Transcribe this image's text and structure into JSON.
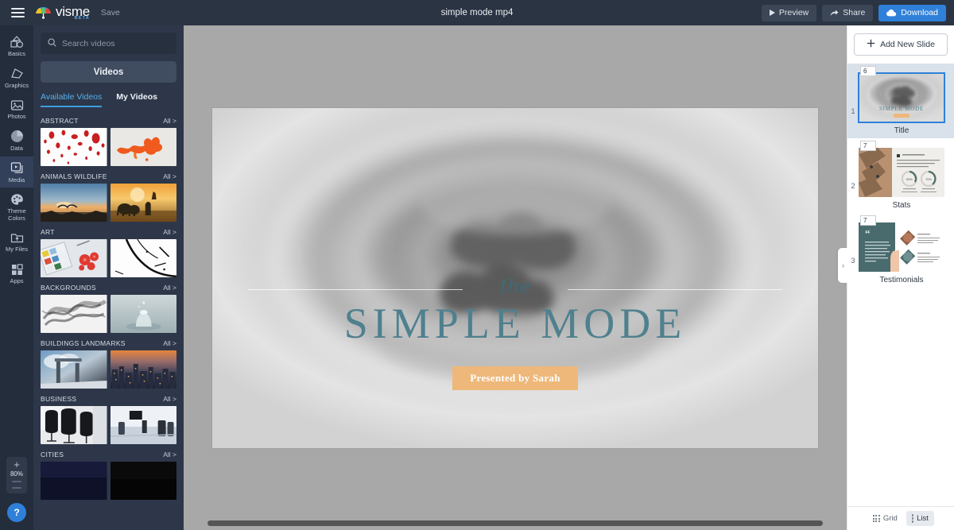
{
  "topbar": {
    "menu_icon": "hamburger-icon",
    "logo_word": "visme",
    "logo_beta": "BETA",
    "save_label": "Save",
    "doc_title": "simple mode mp4",
    "actions": [
      {
        "label": "Preview",
        "icon": "play-icon",
        "primary": false
      },
      {
        "label": "Share",
        "icon": "share-arrow-icon",
        "primary": false
      },
      {
        "label": "Download",
        "icon": "cloud-download-icon",
        "primary": true
      }
    ]
  },
  "rail": {
    "items": [
      {
        "label": "Basics",
        "icon": "shapes-icon",
        "active": false
      },
      {
        "label": "Graphics",
        "icon": "graphics-icon",
        "active": false
      },
      {
        "label": "Photos",
        "icon": "photo-icon",
        "active": false
      },
      {
        "label": "Data",
        "icon": "pie-chart-icon",
        "active": false
      },
      {
        "label": "Media",
        "icon": "media-play-icon",
        "active": true
      },
      {
        "label": "Theme\nColors",
        "icon": "palette-icon",
        "active": false
      },
      {
        "label": "My Files",
        "icon": "folder-upload-icon",
        "active": false
      },
      {
        "label": "Apps",
        "icon": "apps-grid-icon",
        "active": false
      }
    ],
    "zoom": {
      "plus": "+",
      "value": "80%",
      "minus": "—"
    },
    "help": "?"
  },
  "panel": {
    "search_placeholder": "Search videos",
    "search_value": "",
    "search_icon": "search-icon",
    "type_selector": "Videos",
    "tabs": [
      {
        "label": "Available Videos",
        "active": true
      },
      {
        "label": "My Videos",
        "active": false
      }
    ],
    "all_label": "All >",
    "categories": [
      {
        "name": "ABSTRACT",
        "thumbs": [
          "abstract-red-splatter",
          "abstract-orange-ink"
        ]
      },
      {
        "name": "ANIMALS WILDLIFE",
        "thumbs": [
          "wildlife-bird-sunset",
          "wildlife-elephants-sunset"
        ]
      },
      {
        "name": "ART",
        "thumbs": [
          "art-paint-palette",
          "art-ink-lines"
        ]
      },
      {
        "name": "BACKGROUNDS",
        "thumbs": [
          "background-smoke",
          "background-water-splash"
        ]
      },
      {
        "name": "BUILDINGS LANDMARKS",
        "thumbs": [
          "building-monument-sky",
          "building-city-skyline"
        ]
      },
      {
        "name": "BUSINESS",
        "thumbs": [
          "business-office-chairs",
          "business-meeting-room"
        ]
      },
      {
        "name": "CITIES",
        "thumbs": [
          "city-night-blue",
          "city-dark-street"
        ]
      }
    ]
  },
  "canvas": {
    "slide": {
      "eyebrow": "the",
      "title": "SIMPLE MODE",
      "presenter": "Presented by Sarah",
      "title_color": "#4f808e",
      "presenter_bg": "#eeb87a"
    },
    "scrollbar": "horizontal-scrollbar"
  },
  "slides_panel": {
    "add_slide_label": "Add New Slide",
    "add_icon": "plus-icon",
    "collapse_icon": "chevron-right-icon",
    "slides": [
      {
        "number": "1",
        "badge": "6",
        "label": "Title",
        "selected": true,
        "art": "title-slide"
      },
      {
        "number": "2",
        "badge": "7",
        "label": "Stats",
        "selected": false,
        "art": "stats-slide"
      },
      {
        "number": "3",
        "badge": "7",
        "label": "Testimonials",
        "selected": false,
        "art": "testimonials-slide"
      }
    ],
    "view_modes": [
      {
        "label": "Grid",
        "icon": "grid-dots-icon",
        "active": false
      },
      {
        "label": "List",
        "icon": "list-dots-icon",
        "active": true
      }
    ]
  }
}
